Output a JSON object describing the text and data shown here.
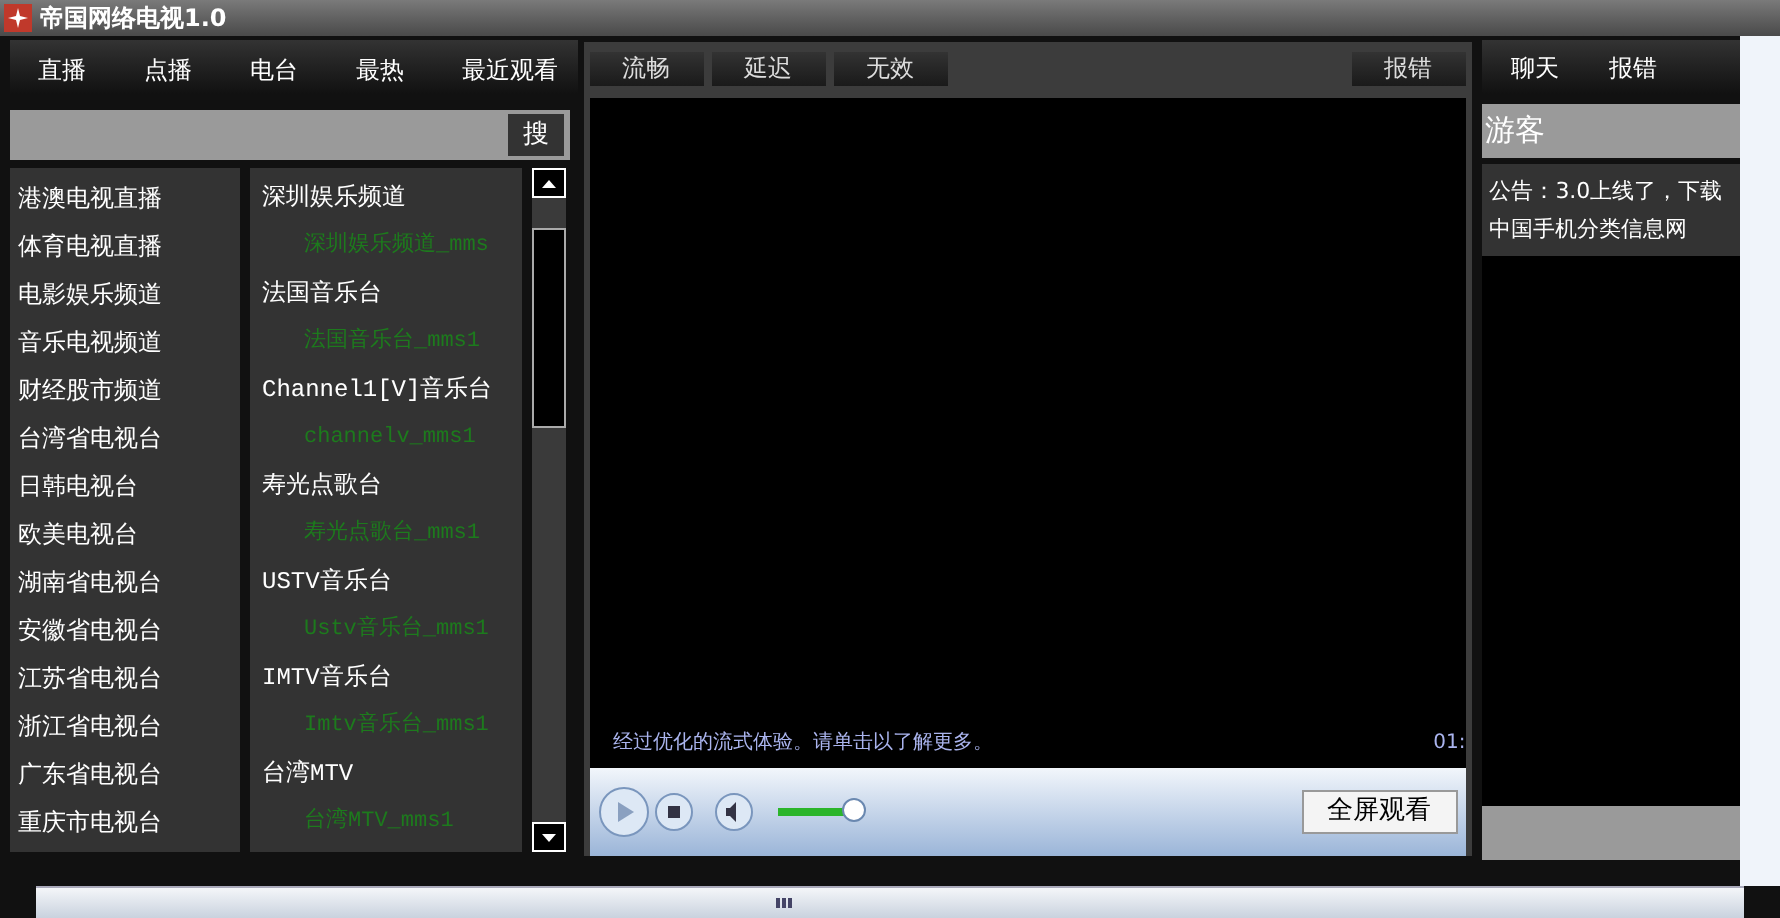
{
  "window": {
    "title": "帝国网络电视1.0"
  },
  "tabs": [
    "直播",
    "点播",
    "电台",
    "最热",
    "最近观看"
  ],
  "search": {
    "button": "搜"
  },
  "categories": [
    "港澳电视直播",
    "体育电视直播",
    "电影娱乐频道",
    "音乐电视频道",
    "财经股市频道",
    "台湾省电视台",
    "日韩电视台",
    "欧美电视台",
    "湖南省电视台",
    "安徽省电视台",
    "江苏省电视台",
    "浙江省电视台",
    "广东省电视台",
    "重庆市电视台"
  ],
  "channels": [
    {
      "kind": "channel",
      "name": "深圳娱乐频道"
    },
    {
      "kind": "source",
      "name": "深圳娱乐频道_mms"
    },
    {
      "kind": "channel",
      "name": "法国音乐台"
    },
    {
      "kind": "source",
      "name": "法国音乐台_mms1"
    },
    {
      "kind": "channel",
      "name": "Channel1[V]音乐台"
    },
    {
      "kind": "source",
      "name": "channelv_mms1"
    },
    {
      "kind": "channel",
      "name": "寿光点歌台"
    },
    {
      "kind": "source",
      "name": "寿光点歌台_mms1"
    },
    {
      "kind": "channel",
      "name": "USTV音乐台"
    },
    {
      "kind": "source",
      "name": "Ustv音乐台_mms1"
    },
    {
      "kind": "channel",
      "name": "IMTV音乐台"
    },
    {
      "kind": "source",
      "name": "Imtv音乐台_mms1"
    },
    {
      "kind": "channel",
      "name": "台湾MTV"
    },
    {
      "kind": "source",
      "name": "台湾MTV_mms1"
    }
  ],
  "player_buttons": [
    "流畅",
    "延迟",
    "无效"
  ],
  "report_button": "报错",
  "player": {
    "status": "经过优化的流式体验。请单击以了解更多。",
    "time": "01:",
    "volume": {
      "level": 0.7
    },
    "fullscreen": "全屏观看"
  },
  "side_tabs": [
    "聊天",
    "报错"
  ],
  "side": {
    "user": "游客",
    "notices": [
      "公告：3.0上线了，下载",
      "中国手机分类信息网"
    ]
  }
}
